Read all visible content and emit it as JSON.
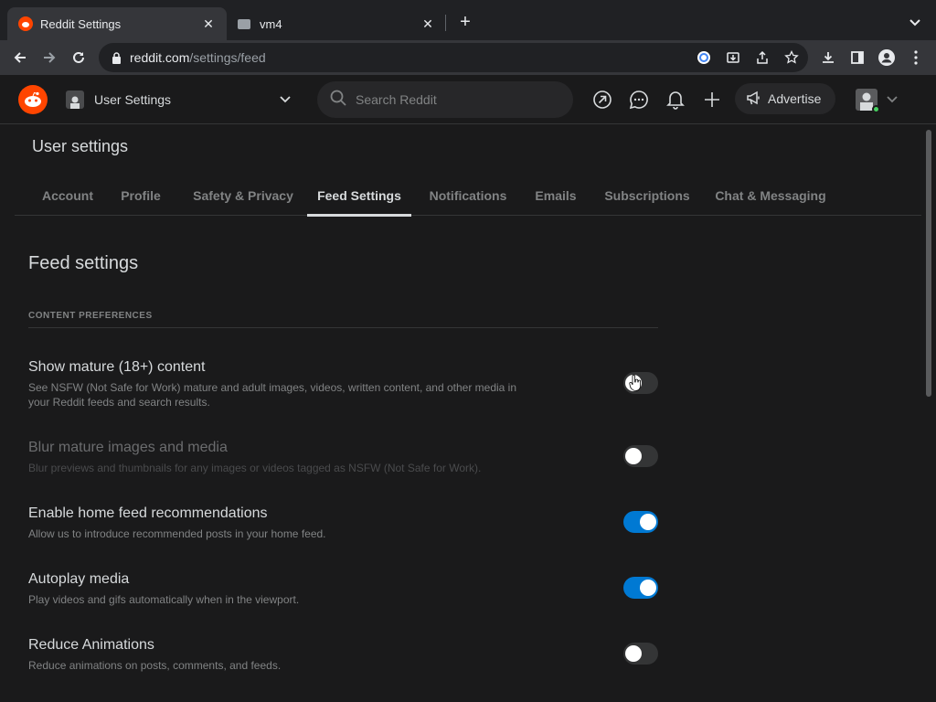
{
  "browser": {
    "tabs": [
      {
        "title": "Reddit Settings",
        "active": true
      },
      {
        "title": "vm4",
        "active": false
      }
    ],
    "url_host": "reddit.com",
    "url_path": "/settings/feed"
  },
  "header": {
    "community_label": "User Settings",
    "search_placeholder": "Search Reddit",
    "advertise_label": "Advertise"
  },
  "settings": {
    "page_title": "User settings",
    "tabs": [
      "Account",
      "Profile",
      "Safety & Privacy",
      "Feed Settings",
      "Notifications",
      "Emails",
      "Subscriptions",
      "Chat & Messaging"
    ],
    "active_tab": "Feed Settings",
    "section_title": "Feed settings",
    "group_label": "CONTENT PREFERENCES",
    "items": [
      {
        "title": "Show mature (18+) content",
        "description": "See NSFW (Not Safe for Work) mature and adult images, videos, written content, and other media in your Reddit feeds and search results.",
        "enabled": false,
        "disabled": false
      },
      {
        "title": "Blur mature images and media",
        "description": "Blur previews and thumbnails for any images or videos tagged as NSFW (Not Safe for Work).",
        "enabled": false,
        "disabled": true
      },
      {
        "title": "Enable home feed recommendations",
        "description": "Allow us to introduce recommended posts in your home feed.",
        "enabled": true,
        "disabled": false
      },
      {
        "title": "Autoplay media",
        "description": "Play videos and gifs automatically when in the viewport.",
        "enabled": true,
        "disabled": false
      },
      {
        "title": "Reduce Animations",
        "description": "Reduce animations on posts, comments, and feeds.",
        "enabled": false,
        "disabled": false
      }
    ]
  },
  "colors": {
    "brand": "#ff4500",
    "toggle_on": "#0079d3",
    "background": "#1a1a1b"
  }
}
